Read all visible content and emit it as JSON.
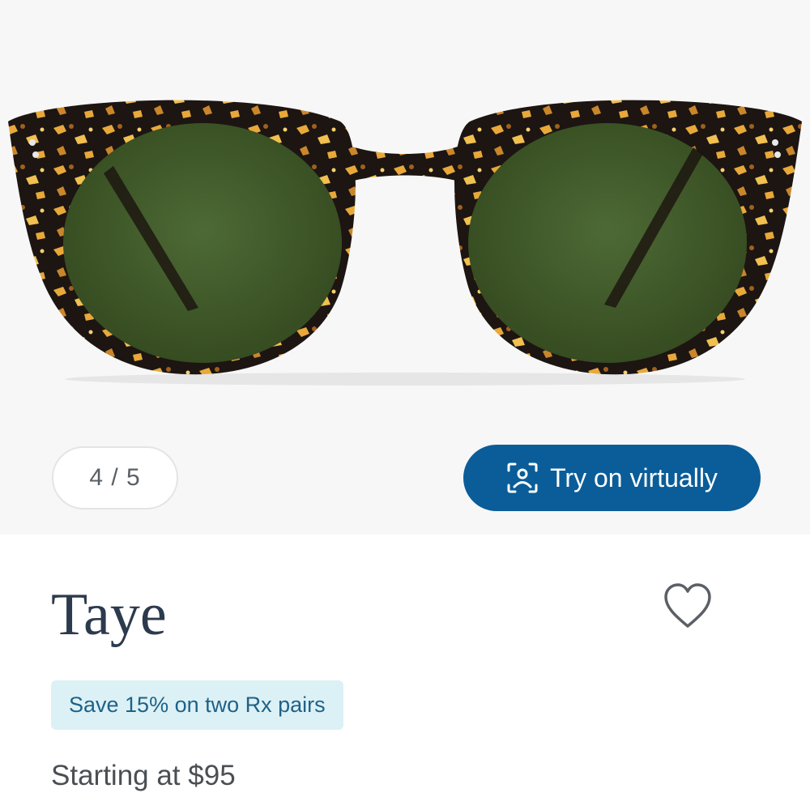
{
  "gallery": {
    "pager_text": "4 / 5"
  },
  "try_on": {
    "label": "Try on virtually",
    "icon": "face-scan-icon",
    "color": "#0a5d98"
  },
  "product": {
    "name": "Taye",
    "favorite_icon": "heart-outline-icon",
    "promo": "Save 15% on two Rx pairs",
    "price_text": "Starting at $95"
  },
  "colors": {
    "frame": "#1c1512",
    "tortoise_spots": "#e8a83a",
    "lens": "#3f5a2c",
    "promo_bg": "#dcf1f6",
    "promo_text": "#1f6287",
    "title": "#2c3a4d"
  }
}
